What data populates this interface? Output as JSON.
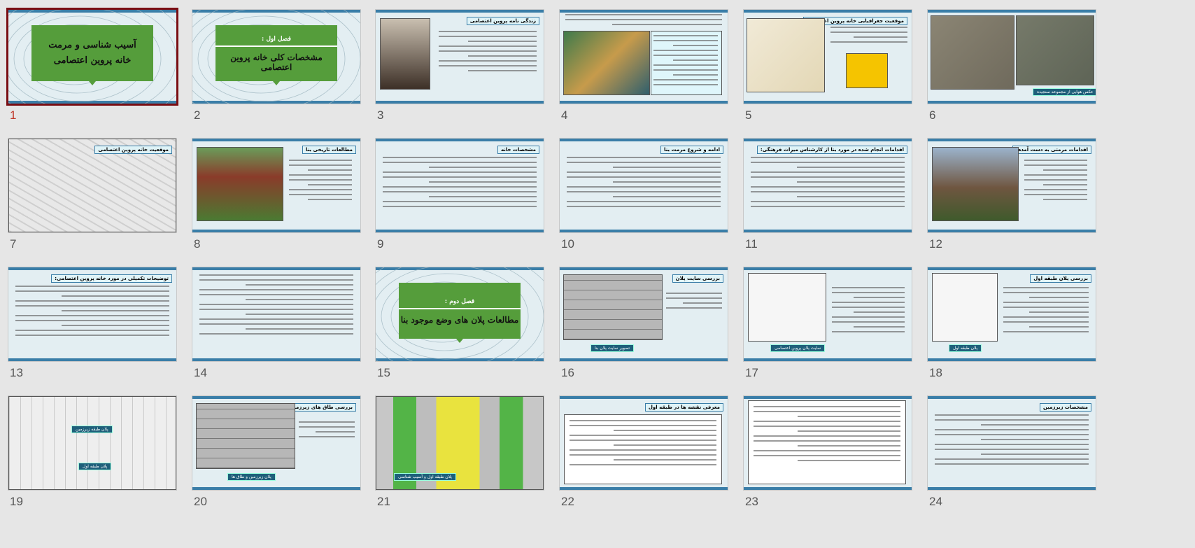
{
  "slides": [
    {
      "number": "1",
      "selected": true,
      "kind": "title",
      "line1": "آسیب شناسی و مرمت",
      "line2": "خانه پروین اعتصامی"
    },
    {
      "number": "2",
      "kind": "section",
      "sub": "فصل اول :",
      "title": "مشخصات کلی خانه پروین اعتصامی"
    },
    {
      "number": "3",
      "kind": "text-image-left",
      "heading": "زندگی نامه پروین اعتصامی"
    },
    {
      "number": "4",
      "kind": "image-text",
      "heading": ""
    },
    {
      "number": "5",
      "kind": "map",
      "heading": "موقعیت جغرافیایی خانه پروین اعتصامی"
    },
    {
      "number": "6",
      "kind": "aerial",
      "caption": "عکس هوایی از مجموعه سنجیده"
    },
    {
      "number": "7",
      "kind": "plan-map",
      "heading": "موقعیت خانه پروین اعتصامی"
    },
    {
      "number": "8",
      "kind": "text-image-left",
      "heading": "مطالعات تاریخی بنا"
    },
    {
      "number": "9",
      "kind": "text",
      "heading": "مشخصات خانه"
    },
    {
      "number": "10",
      "kind": "text",
      "heading": "ادامه و شروع مرمت بنا"
    },
    {
      "number": "11",
      "kind": "text",
      "heading": "اقدامات انجام شده در مورد بنا از کارشناس میراث فرهنگی:"
    },
    {
      "number": "12",
      "kind": "text-image-left",
      "heading": "اقدامات مرمتی به دست آمده:"
    },
    {
      "number": "13",
      "kind": "text",
      "heading": "توضیحات تکمیلی در مورد خانه پروین اعتصامی:"
    },
    {
      "number": "14",
      "kind": "text",
      "heading": ""
    },
    {
      "number": "15",
      "kind": "section",
      "sub": "فصل دوم :",
      "title": "مطالعات پلان های وضع موجود بنا"
    },
    {
      "number": "16",
      "kind": "plan",
      "heading": "بررسی سایت پلان",
      "caption": "تصویر سایت پلان بنا"
    },
    {
      "number": "17",
      "kind": "plan-left",
      "heading": "",
      "caption": "سایت پلان پروین اعتصامی"
    },
    {
      "number": "18",
      "kind": "plan-left",
      "heading": "بررسی پلان طبقه اول",
      "caption": "پلان طبقه اول"
    },
    {
      "number": "19",
      "kind": "plans",
      "heading": "",
      "caption": "پلان طبقه زیرزمین",
      "caption2": "پلان طبقه اول"
    },
    {
      "number": "20",
      "kind": "plan",
      "heading": "بررسی طاق های زیرزمین",
      "caption": "پلان زیرزمین و طاق ها"
    },
    {
      "number": "21",
      "kind": "colored-plan",
      "heading": "",
      "caption": "پلان طبقه اول و آسیب شناسی"
    },
    {
      "number": "22",
      "kind": "boxed-text",
      "heading": "معرفی نقشه ها در طبقه اول"
    },
    {
      "number": "23",
      "kind": "boxed-text",
      "heading": ""
    },
    {
      "number": "24",
      "kind": "text",
      "heading": "مشخصات زیرزمین"
    }
  ],
  "colors": {
    "green": "#559d3b",
    "bar": "#3a7ea8",
    "selected": "#7a0d12",
    "background": "#e6e6e6"
  }
}
